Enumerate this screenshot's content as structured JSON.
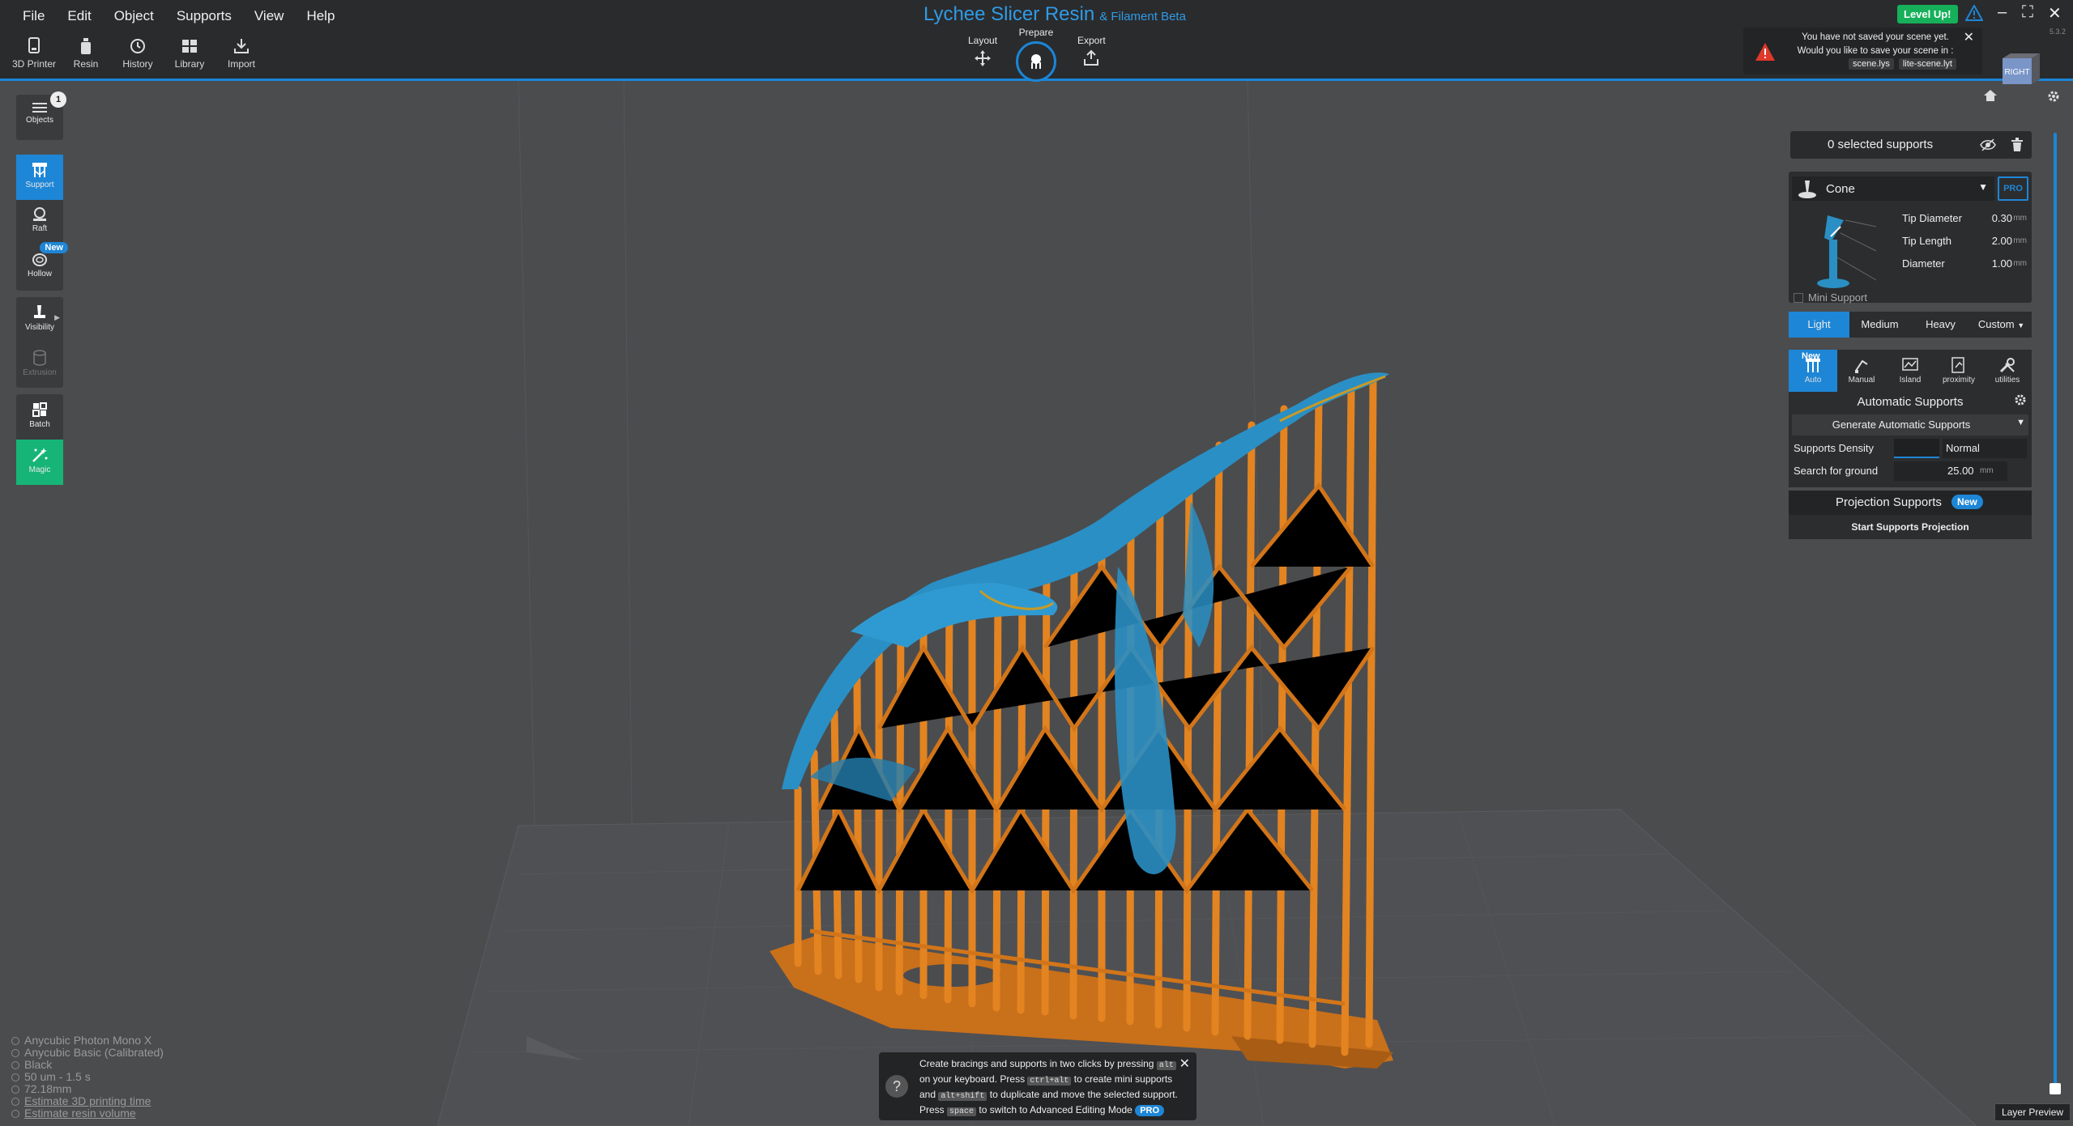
{
  "menu": [
    "File",
    "Edit",
    "Object",
    "Supports",
    "View",
    "Help"
  ],
  "app": {
    "title": "Lychee Slicer Resin",
    "subtitle": "& Filament Beta",
    "level_up": "Level Up!"
  },
  "toolbar": [
    "3D Printer",
    "Resin",
    "History",
    "Library",
    "Import"
  ],
  "modes": {
    "layout": "Layout",
    "prepare": "Prepare",
    "export": "Export"
  },
  "save_notice": {
    "text": "You have not saved your scene yet. Would you like to save your scene in :",
    "file1": "scene.lys",
    "file2": "lite-scene.lyt"
  },
  "viewcube": {
    "label": "RIGHT",
    "version": "5.3.2"
  },
  "left_tools": {
    "objects": "Objects",
    "objects_count": "1",
    "support": "Support",
    "raft": "Raft",
    "hollow": "Hollow",
    "hollow_badge": "New",
    "visibility": "Visibility",
    "extrusion": "Extrusion",
    "batch": "Batch",
    "magic": "Magic"
  },
  "supports_panel": {
    "selected": "0 selected supports",
    "tip_type": "Cone",
    "pro": "PRO",
    "params": [
      {
        "name": "Tip Diameter",
        "value": "0.30",
        "unit": "mm"
      },
      {
        "name": "Tip Length",
        "value": "2.00",
        "unit": "mm"
      },
      {
        "name": "Diameter",
        "value": "1.00",
        "unit": "mm"
      }
    ],
    "mini_support": "Mini Support",
    "density_tabs": [
      "Light",
      "Medium",
      "Heavy",
      "Custom"
    ],
    "mode_tabs": [
      "Auto",
      "Manual",
      "Island",
      "proximity",
      "utilities"
    ],
    "auto_new": "New",
    "auto_title": "Automatic Supports",
    "generate": "Generate Automatic Supports",
    "density_label": "Supports Density",
    "density_value": "Normal",
    "ground_label": "Search for ground",
    "ground_value": "25.00",
    "ground_unit": "mm",
    "projection": "Projection Supports",
    "projection_badge": "New",
    "projection_start": "Start Supports Projection"
  },
  "layer_preview": "Layer Preview",
  "info": {
    "printer": "Anycubic Photon Mono X",
    "resin": "Anycubic Basic (Calibrated)",
    "color": "Black",
    "layer": "50 um - 1.5 s",
    "height": "72.18mm",
    "estimate_time": "Estimate 3D printing time",
    "estimate_volume": "Estimate resin volume"
  },
  "tip": {
    "t1": "Create bracings and supports in two clicks by pressing",
    "k1": "alt",
    "t2": "on your keyboard. Press",
    "k2": "ctrl+alt",
    "t3": "to create mini supports and",
    "k3": "alt+shift",
    "t4": "to duplicate and move the selected support. Press",
    "k4": "space",
    "t5": "to switch to Advanced Editing Mode",
    "pro": "PRO"
  },
  "colors": {
    "accent": "#1e86d6",
    "model": "#2a8fc4",
    "supports": "#e07f1d",
    "magic": "#16b577"
  }
}
